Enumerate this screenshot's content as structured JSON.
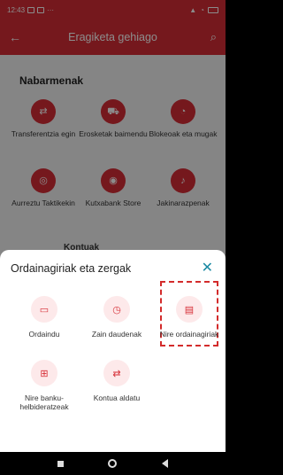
{
  "statusbar": {
    "time": "12:43",
    "dots": "···"
  },
  "appbar": {
    "title": "Eragiketa gehiago"
  },
  "main": {
    "section_title": "Nabarmenak",
    "items": [
      {
        "label": "Transferentzia egin",
        "icon": "transfer-icon"
      },
      {
        "label": "Erosketak baimendu",
        "icon": "cart-icon"
      },
      {
        "label": "Blokeoak eta mugak",
        "icon": "gauge-icon"
      },
      {
        "label": "Aurreztu Taktikekin",
        "icon": "piggy-icon"
      },
      {
        "label": "Kutxabank Store",
        "icon": "store-icon"
      },
      {
        "label": "Jakinarazpenak",
        "icon": "bell-icon"
      }
    ],
    "accounts_label": "Kontuak"
  },
  "sheet": {
    "title": "Ordainagiriak eta zergak",
    "options": [
      {
        "label": "Ordaindu",
        "icon": "pay-icon"
      },
      {
        "label": "Zain daudenak",
        "icon": "clock-icon"
      },
      {
        "label": "Nire ordainagiriak",
        "icon": "receipt-icon"
      },
      {
        "label": "Nire banku-helbideratzeak",
        "icon": "bank-direct-debit-icon"
      },
      {
        "label": "Kontua aldatu",
        "icon": "swap-icon"
      }
    ]
  },
  "colors": {
    "brand": "#d62d35",
    "accent": "#1b8aa3"
  }
}
